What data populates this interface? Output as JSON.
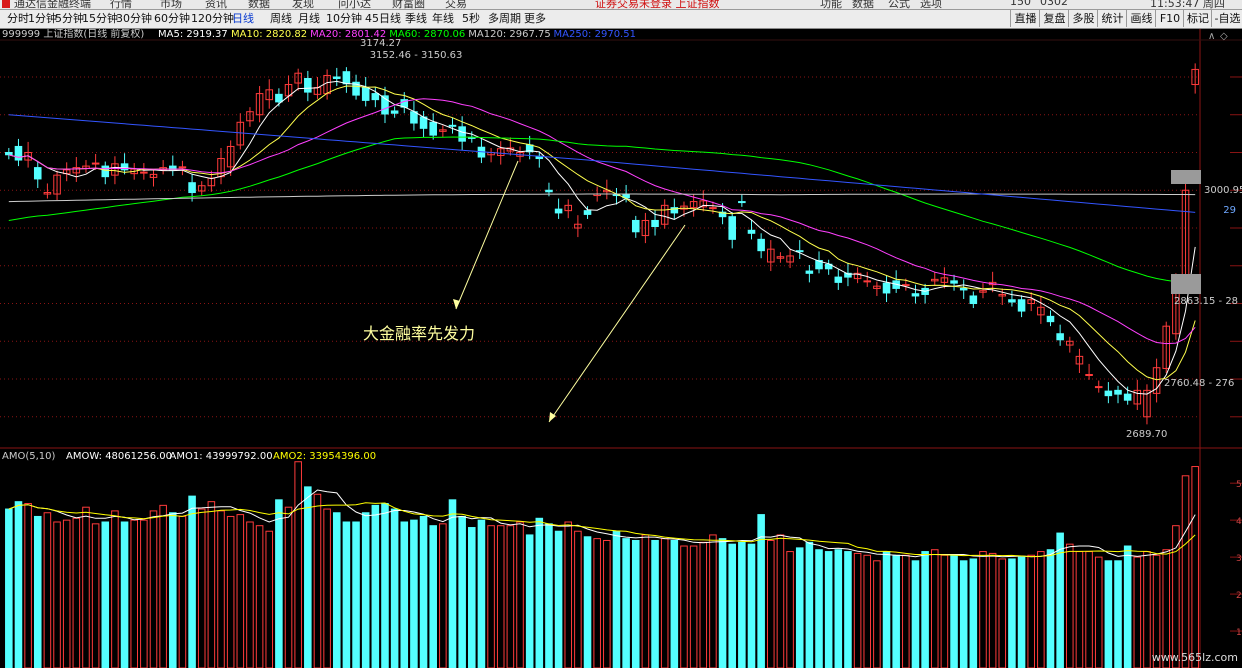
{
  "app": {
    "menu": [
      {
        "label": "通达信金融终端",
        "color": "#333333"
      },
      {
        "label": "行情",
        "color": "#333333"
      },
      {
        "label": "市场",
        "color": "#333333"
      },
      {
        "label": "资讯",
        "color": "#333333"
      },
      {
        "label": "数据",
        "color": "#333333"
      },
      {
        "label": "发现",
        "color": "#333333"
      },
      {
        "label": "问小达",
        "color": "#333333"
      },
      {
        "label": "财富圈",
        "color": "#333333"
      },
      {
        "label": "交易",
        "color": "#333333"
      },
      {
        "label": "证券交易未登录 上证指数",
        "color": "#d01010"
      },
      {
        "label": "功能",
        "color": "#333333"
      },
      {
        "label": "数据",
        "color": "#333333"
      },
      {
        "label": "公式",
        "color": "#333333"
      },
      {
        "label": "选项",
        "color": "#333333"
      },
      {
        "label": "150",
        "color": "#333333"
      },
      {
        "label": "0302",
        "color": "#333333"
      },
      {
        "label": "11:53:47 周四",
        "color": "#333333"
      }
    ],
    "periods": [
      "分时",
      "1分钟",
      "5分钟",
      "15分钟",
      "30分钟",
      "60分钟",
      "120分钟",
      "日线",
      "周线",
      "月线",
      "10分钟",
      "45日线",
      "季线",
      "年线",
      "5秒",
      "多周期",
      "更多"
    ],
    "active_period": "日线",
    "right_buttons": [
      "直播",
      "复盘",
      "多股",
      "统计",
      "画线",
      "F10",
      "标记",
      "-自选"
    ]
  },
  "colors": {
    "up": "#ff3b3b",
    "down": "#54ffff",
    "ma5": "#ffffff",
    "ma10": "#ffff4d",
    "ma20": "#ff40ff",
    "ma60": "#00ff00",
    "ma120": "#cccccc",
    "ma250": "#3355ff",
    "amow": "#ffffff",
    "amo1": "#ffffff",
    "amo2": "#ffff00",
    "grid": "#8a1414",
    "annotation": "#ffffa0"
  },
  "chart_data": [
    {
      "type": "candlestick",
      "title": "999999 上证指数(日线 前复权)",
      "indicator_legend": [
        {
          "name": "MA5",
          "value": "2919.37",
          "color": "#ffffff"
        },
        {
          "name": "MA10",
          "value": "2820.82",
          "color": "#ffff4d"
        },
        {
          "name": "MA20",
          "value": "2801.42",
          "color": "#ff40ff"
        },
        {
          "name": "MA60",
          "value": "2870.06",
          "color": "#00ff00"
        },
        {
          "name": "MA120",
          "value": "2967.75",
          "color": "#cccccc"
        },
        {
          "name": "MA250",
          "value": "2970.51",
          "color": "#3355ff"
        }
      ],
      "y_range": [
        2660,
        3195
      ],
      "open": [
        3050,
        3058,
        3040,
        3030,
        2995,
        2995,
        3022,
        3023,
        3029,
        3035,
        3032,
        3020,
        3035,
        3022,
        3024,
        3017,
        3027,
        3032,
        3030,
        3010,
        2999,
        3006,
        3018,
        3031,
        3060,
        3092,
        3100,
        3120,
        3127,
        3125,
        3142,
        3148,
        3127,
        3128,
        3150,
        3157,
        3143,
        3136,
        3128,
        3125,
        3105,
        3120,
        3104,
        3097,
        3090,
        3078,
        3086,
        3084,
        3070,
        3057,
        3047,
        3046,
        3052,
        3045,
        3060,
        3045,
        3000,
        2975,
        2973,
        2950,
        2973,
        2993,
        2998,
        2995,
        2995,
        2960,
        2940,
        2960,
        2955,
        2977,
        2975,
        2977,
        2978,
        2977,
        2971,
        2965,
        2985,
        2947,
        2935,
        2905,
        2910,
        2905,
        2920,
        2893,
        2907,
        2902,
        2885,
        2890,
        2883,
        2880,
        2870,
        2877,
        2880,
        2875,
        2863,
        2870,
        2880,
        2878,
        2880,
        2870,
        2860,
        2865,
        2875,
        2860,
        2855,
        2855,
        2850,
        2835,
        2833,
        2810,
        2795,
        2770,
        2755,
        2740,
        2734,
        2735,
        2730,
        2717,
        2700,
        2731,
        2764,
        2810,
        2880,
        3140
      ],
      "close": [
        3047,
        3040,
        3050,
        3015,
        2997,
        3020,
        3027,
        3030,
        3032,
        3036,
        3018,
        3035,
        3027,
        3028,
        3024,
        3021,
        3030,
        3027,
        3031,
        2997,
        3006,
        3016,
        3042,
        3058,
        3090,
        3104,
        3128,
        3133,
        3117,
        3140,
        3155,
        3130,
        3136,
        3152,
        3148,
        3141,
        3126,
        3119,
        3120,
        3101,
        3102,
        3110,
        3089,
        3082,
        3073,
        3080,
        3085,
        3065,
        3069,
        3044,
        3050,
        3055,
        3056,
        3050,
        3051,
        3042,
        2998,
        2970,
        2980,
        2955,
        2968,
        2995,
        3000,
        2993,
        2990,
        2945,
        2960,
        2952,
        2980,
        2970,
        2979,
        2985,
        2986,
        2977,
        2965,
        2935,
        2984,
        2943,
        2920,
        2922,
        2912,
        2913,
        2919,
        2890,
        2896,
        2896,
        2878,
        2885,
        2890,
        2880,
        2873,
        2864,
        2870,
        2875,
        2860,
        2862,
        2882,
        2884,
        2877,
        2868,
        2850,
        2867,
        2878,
        2862,
        2852,
        2840,
        2855,
        2845,
        2826,
        2802,
        2800,
        2780,
        2756,
        2740,
        2728,
        2730,
        2722,
        2735,
        2735,
        2765,
        2820,
        2880,
        3000,
        3160
      ],
      "annotations": [
        {
          "label": "3174.27",
          "bar": 36
        },
        {
          "label": "3152.46 - 3150.63",
          "bar": 37
        },
        {
          "label": "3000.95",
          "bar": 123
        },
        {
          "label": "2863.15 - 28",
          "bar": 123
        },
        {
          "label": "2760.48 - 276",
          "bar": 119
        },
        {
          "label": "2689.70",
          "bar": 115
        }
      ],
      "right_axis_label": "29",
      "text_annotation": "大金融率先发力"
    },
    {
      "type": "bar",
      "title": "AMO(5,10)",
      "indicator_legend": [
        {
          "name": "AMOW",
          "value": "48061256.00",
          "color": "#ffffff"
        },
        {
          "name": "AMO1",
          "value": "43999792.00",
          "color": "#ffffff"
        },
        {
          "name": "AMO2",
          "value": "33954396.00",
          "color": "#ffff00"
        }
      ],
      "y_range": [
        0,
        5600
      ],
      "values": [
        4300,
        4500,
        4450,
        4100,
        4200,
        3950,
        4000,
        4050,
        4350,
        3900,
        3950,
        4250,
        3950,
        4000,
        4000,
        4250,
        4400,
        4200,
        4100,
        4650,
        4300,
        4500,
        4250,
        4100,
        4150,
        3950,
        3850,
        3700,
        4550,
        4350,
        5580,
        4900,
        4700,
        4300,
        4200,
        3950,
        3950,
        4200,
        4400,
        4450,
        4300,
        3950,
        4000,
        4100,
        3850,
        3900,
        4550,
        4100,
        3800,
        4000,
        3850,
        3850,
        3850,
        3950,
        3600,
        4050,
        3900,
        3700,
        3950,
        3700,
        3550,
        3500,
        3450,
        3700,
        3500,
        3450,
        3600,
        3450,
        3500,
        3450,
        3300,
        3300,
        3400,
        3600,
        3500,
        3350,
        3400,
        3350,
        4150,
        3450,
        3600,
        3150,
        3250,
        3400,
        3200,
        3150,
        3200,
        3150,
        3100,
        3050,
        2900,
        3150,
        3050,
        3050,
        2900,
        3150,
        3200,
        3050,
        3050,
        2900,
        2950,
        3150,
        3100,
        2950,
        2950,
        3000,
        3050,
        3150,
        3200,
        3650,
        3350,
        3150,
        3150,
        3000,
        2900,
        2900,
        3300,
        3000,
        3150,
        3050,
        3200,
        3850,
        5200,
        5450
      ]
    }
  ]
}
